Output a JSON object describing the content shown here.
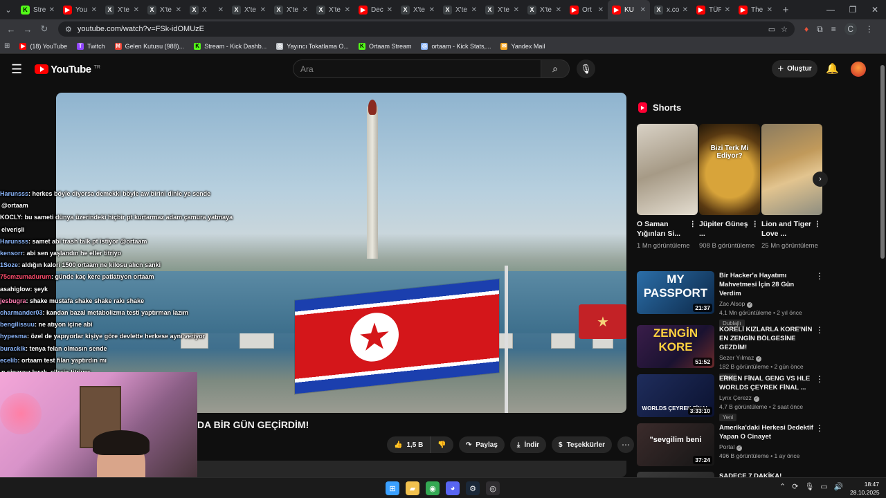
{
  "browser": {
    "tabs": [
      {
        "label": "Stre",
        "icon": "kick-icon",
        "color": "#53fc18"
      },
      {
        "label": "You",
        "icon": "youtube-icon",
        "color": "#ff0000"
      },
      {
        "label": "X'te",
        "icon": "x-icon",
        "color": "#000000"
      },
      {
        "label": "X'te",
        "icon": "x-icon",
        "color": "#000000"
      },
      {
        "label": "X",
        "icon": "x-icon",
        "color": "#000000"
      },
      {
        "label": "X'te",
        "icon": "x-icon",
        "color": "#000000"
      },
      {
        "label": "X'te",
        "icon": "x-icon",
        "color": "#000000"
      },
      {
        "label": "X'te",
        "icon": "x-icon",
        "color": "#000000"
      },
      {
        "label": "Dec",
        "icon": "youtube-icon",
        "color": "#ff0000"
      },
      {
        "label": "X'te",
        "icon": "x-icon",
        "color": "#000000"
      },
      {
        "label": "X'te",
        "icon": "x-icon",
        "color": "#000000"
      },
      {
        "label": "X'te",
        "icon": "x-icon",
        "color": "#000000"
      },
      {
        "label": "X'te",
        "icon": "x-icon",
        "color": "#000000"
      },
      {
        "label": "Ort",
        "icon": "youtube-icon",
        "color": "#ff0000"
      },
      {
        "label": "KU",
        "icon": "youtube-icon",
        "color": "#ff0000",
        "active": true
      },
      {
        "label": "x.co",
        "icon": "x-icon",
        "color": "#000000"
      },
      {
        "label": "TÜF",
        "icon": "youtube-icon",
        "color": "#ff0000"
      },
      {
        "label": "The",
        "icon": "youtube-icon",
        "color": "#ff0000"
      }
    ],
    "url": "youtube.com/watch?v=FSk-idOMUzE",
    "profile_initial": "C",
    "bookmarks": [
      {
        "label": "(18) YouTube",
        "icon": "youtube-icon",
        "color": "#ff0000"
      },
      {
        "label": "Twitch",
        "icon": "twitch-icon",
        "color": "#9146ff"
      },
      {
        "label": "Gelen Kutusu (988)...",
        "icon": "gmail-icon",
        "color": "#ea4335"
      },
      {
        "label": "Stream - Kick Dashb...",
        "icon": "kick-icon",
        "color": "#53fc18"
      },
      {
        "label": "Yayıncı Tokatlama O...",
        "icon": "globe-icon",
        "color": "#bdc1c6"
      },
      {
        "label": "Ortaam Stream",
        "icon": "kick-icon",
        "color": "#53fc18"
      },
      {
        "label": "ortaam - Kick Stats,...",
        "icon": "globe-icon",
        "color": "#8ab4f8"
      },
      {
        "label": "Yandex Mail",
        "icon": "mail-icon",
        "color": "#f5a623"
      }
    ]
  },
  "youtube": {
    "logo_text": "YouTube",
    "logo_region": "TR",
    "search_placeholder": "Ara",
    "create_label": "Oluştur",
    "video_title": "DA BİR GÜN GEÇİRDİM!",
    "likes": "1,5 B",
    "share_label": "Paylaş",
    "download_label": "İndir",
    "thanks_label": "Teşekkürler",
    "shorts_header": "Shorts",
    "shorts": [
      {
        "title": "O Saman Yığınları Si...",
        "views": "1 Mn görüntüleme",
        "thumb_text": ""
      },
      {
        "title": "Jüpiter Güneş ...",
        "views": "908 B görüntüleme",
        "thumb_text": "Bizi Terk Mi Ediyor?"
      },
      {
        "title": "Lion and Tiger Love ...",
        "views": "25 Mn görüntüleme",
        "thumb_text": ""
      }
    ],
    "recommendations": [
      {
        "title": "Bir Hacker'a Hayatımı Mahvetmesi İçin 28 Gün Verdim",
        "channel": "Zac Alsop",
        "views": "4,1 Mn görüntüleme • 2 yıl önce",
        "duration": "21:37",
        "badge": "Dublajlı",
        "thumb_text": "MY PASSPORT"
      },
      {
        "title": "KORELİ KIZLARLA KORE'NİN EN ZENGİN BÖLGESİNE GEZDİM!",
        "channel": "Sezer Yılmaz",
        "views": "182 B görüntüleme • 2 gün önce",
        "duration": "51:52",
        "badge": "Yeni",
        "thumb_text": "ZENGİN KORE"
      },
      {
        "title": "ERKEN FİNAL GENG VS HLE WORLDS ÇEYREK FİNAL ...",
        "channel": "Lynx Çerezz",
        "views": "4,7 B görüntüleme • 2 saat önce",
        "duration": "3:33:10",
        "badge": "Yeni",
        "thumb_text": "WORLDS ÇEYREK FİNAL"
      },
      {
        "title": "Amerika'daki Herkesi Dedektif Yapan O Cinayet",
        "channel": "Portal",
        "views": "496 B görüntüleme • 1 ay önce",
        "duration": "37:24",
        "badge": "",
        "thumb_text": "\"sevgilim beni"
      },
      {
        "title": "SADECE 7 DAKİKA!",
        "channel": "",
        "views": "",
        "duration": "",
        "badge": "",
        "thumb_text": ""
      }
    ]
  },
  "stream_chat": [
    {
      "user": "Harunsss",
      "user_color": "#8ab4f8",
      "text": ": herkes böyle diyorsa demekki böyle aw birini dinle ye sende"
    },
    {
      "user": "",
      "user_color": "#ffffff",
      "text": "@ortaam"
    },
    {
      "user": "KOCLY",
      "user_color": "#ffffff",
      "text": ": bu sameti dünya üzerindeki hiçbir pt kurtarmaz adam çamura yatmaya"
    },
    {
      "user": "",
      "user_color": "#ffffff",
      "text": "elverişli"
    },
    {
      "user": "Harunsss",
      "user_color": "#8ab4f8",
      "text": ": samet abi trash talk pt istiyor @ortaam"
    },
    {
      "user": "kensorr",
      "user_color": "#8ab4f8",
      "text": ": abi sen yaşlandın he eller titriyo"
    },
    {
      "user": "1Soze",
      "user_color": "#8ab4f8",
      "text": ": aldığın kalori 1500 ortaam ne kilosu alıcn sanki"
    },
    {
      "user": "75cmzumadurum",
      "user_color": "#ff4d6d",
      "text": ": günde kaç kere patlatıyon ortaam"
    },
    {
      "user": "asahiglow",
      "user_color": "#ffffff",
      "text": ": şeyk"
    },
    {
      "user": "jesbugra",
      "user_color": "#ff7eb3",
      "text": ": shake mustafa shake shake rakı shake"
    },
    {
      "user": "charmander03",
      "user_color": "#8ab4f8",
      "text": ": kandan bazal metabolizma testi yaptırman lazım"
    },
    {
      "user": "bengilissuu",
      "user_color": "#8ab4f8",
      "text": ": ne atıyon içine abi"
    },
    {
      "user": "hypesma",
      "user_color": "#8ab4f8",
      "text": ": özel de yapıyorlar kişiye göre devlette herkese aynı veriyor"
    },
    {
      "user": "buracklk",
      "user_color": "#8ab4f8",
      "text": ": tenya felan olmasın sende"
    },
    {
      "user": "ecelib",
      "user_color": "#8ab4f8",
      "text": ": ortaam test filan yaptırdın mı"
    },
    {
      "user": "",
      "user_color": "#ffffff",
      "text": "n sigarayı bırak, ellerin titriyor"
    }
  ],
  "taskbar": {
    "apps": [
      "windows-icon",
      "folder-icon",
      "chrome-icon",
      "discord-icon",
      "steam-icon",
      "obs-icon"
    ],
    "time": "18:47",
    "date": "28.10.2025"
  }
}
